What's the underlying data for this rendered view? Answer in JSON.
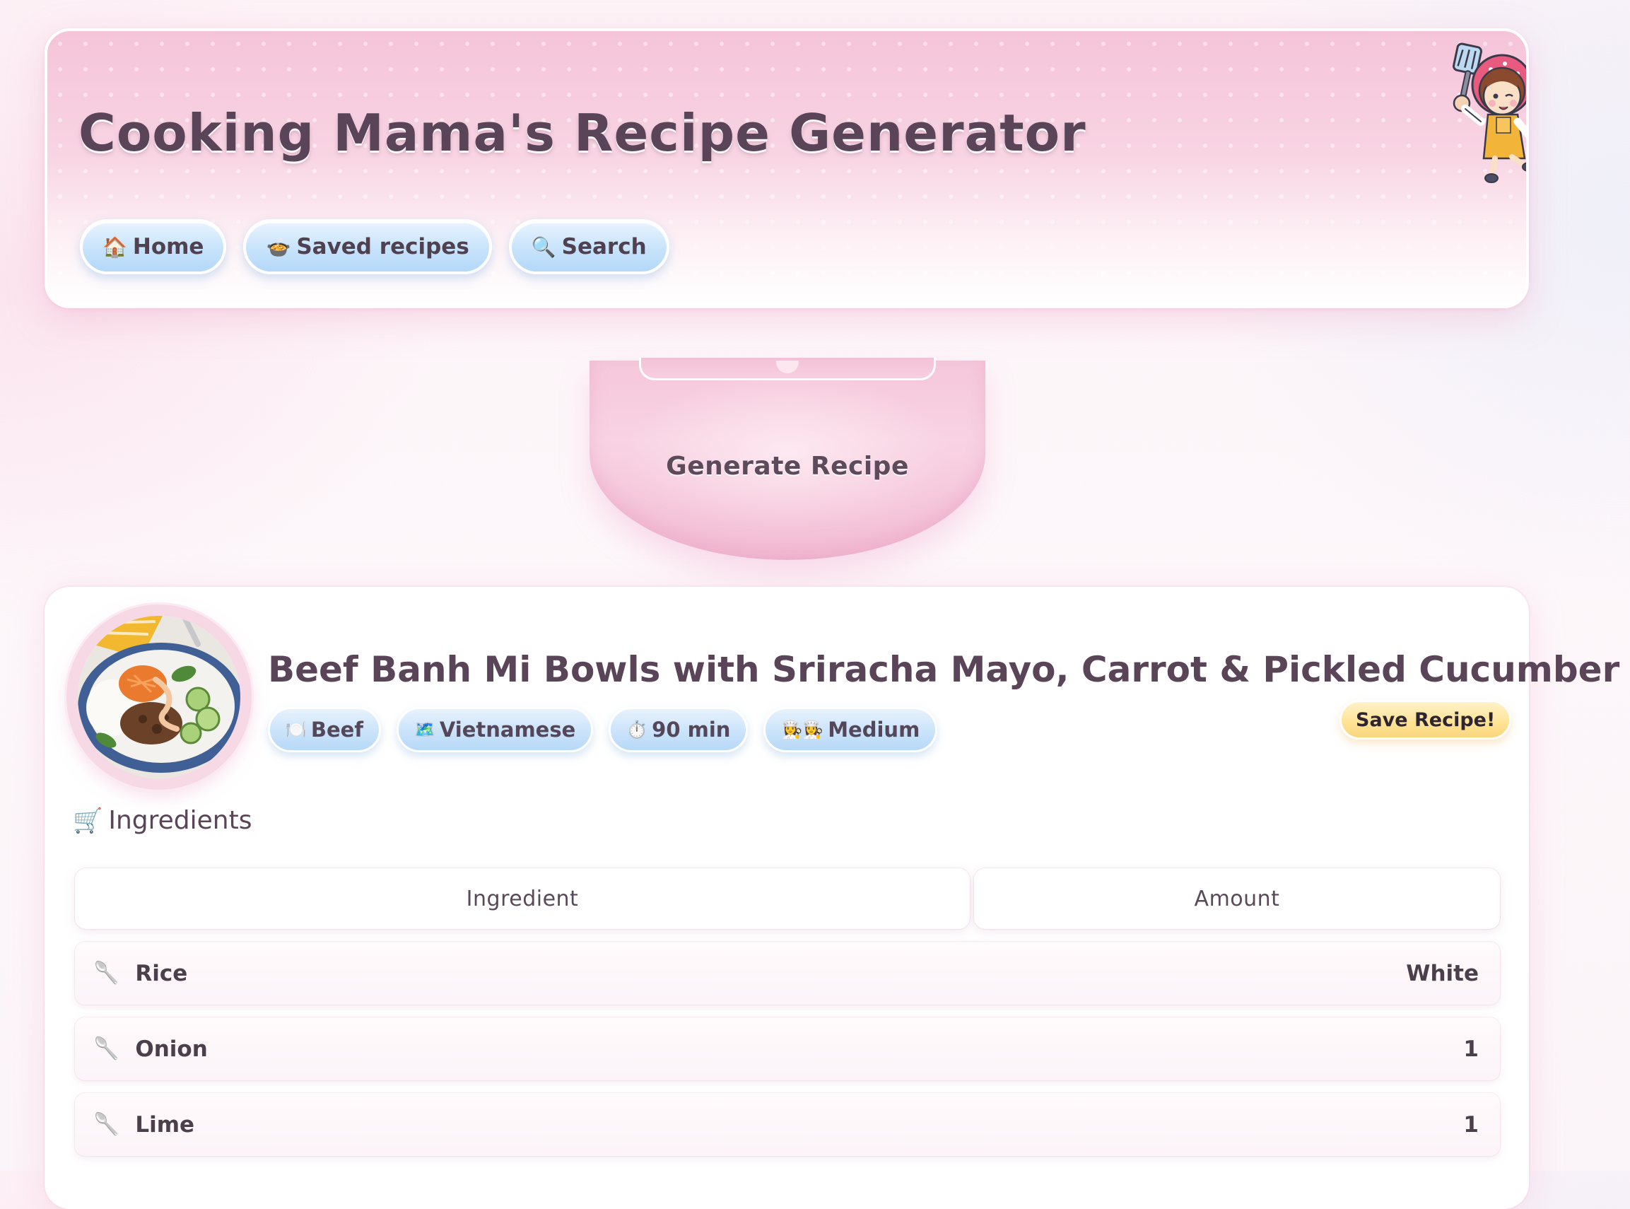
{
  "header": {
    "title": "Cooking Mama's Recipe Generator",
    "nav": [
      {
        "label": "Home",
        "icon": "house-icon",
        "glyph": "🏠"
      },
      {
        "label": "Saved recipes",
        "icon": "bowl-icon",
        "glyph": "🍲"
      },
      {
        "label": "Search",
        "icon": "magnifier-icon",
        "glyph": "🔍"
      }
    ]
  },
  "generate": {
    "label": "Generate Recipe"
  },
  "recipe": {
    "title": "Beef Banh Mi Bowls with Sriracha Mayo, Carrot & Pickled Cucumber",
    "tags": [
      {
        "label": "Beef",
        "icon": "plate-cutlery-icon",
        "glyph": "🍽️"
      },
      {
        "label": "Vietnamese",
        "icon": "map-icon",
        "glyph": "🗺️"
      },
      {
        "label": "90 min",
        "icon": "stopwatch-icon",
        "glyph": "⏱️"
      },
      {
        "label": "Medium",
        "icon": "chef-icon",
        "glyph": "👩‍🍳👩‍🍳"
      }
    ],
    "save_label": "Save Recipe!",
    "ingredients_heading": "Ingredients",
    "ingredients_icon": {
      "icon": "cart-icon",
      "glyph": "🛒"
    },
    "table": {
      "col_ingredient": "Ingredient",
      "col_amount": "Amount",
      "row_icon": "spoon-icon",
      "row_glyph": "🥄",
      "rows": [
        {
          "name": "Rice",
          "amount": "White"
        },
        {
          "name": "Onion",
          "amount": "1"
        },
        {
          "name": "Lime",
          "amount": "1"
        }
      ]
    }
  },
  "colors": {
    "header_pink": "#f5c4d9",
    "pill_blue": "#c7e3fb",
    "save_yellow": "#ffe394",
    "text": "#5a4458"
  }
}
